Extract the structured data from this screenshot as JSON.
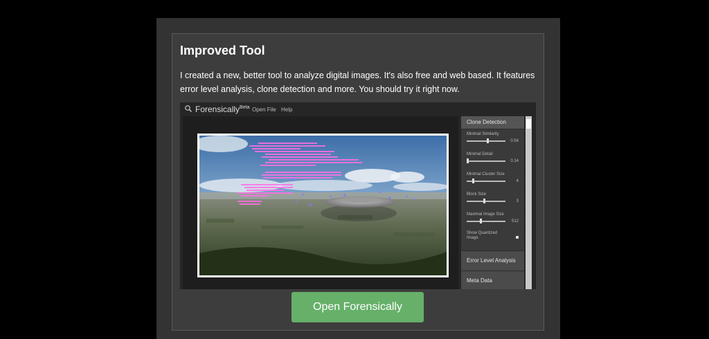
{
  "card": {
    "title": "Improved Tool",
    "description": "I created a new, better tool to analyze digital images. It's also free and web based. It features error level analysis, clone detection and more. You should try it right now."
  },
  "screenshot": {
    "app_name": "Forensically",
    "app_badge": "Beta",
    "menu": [
      "Open File",
      "Help"
    ],
    "panel_header": "Clone Detection",
    "controls": [
      {
        "label": "Minimal Similarity",
        "value": "0.54",
        "level": 0.54
      },
      {
        "label": "Minimal Detail",
        "value": "0.14",
        "level": 0.0
      },
      {
        "label": "Minimal Cluster Size",
        "value": "4",
        "level": 0.15
      },
      {
        "label": "Block Size",
        "value": "3",
        "level": 0.45
      },
      {
        "label": "Maximal Image Size",
        "value": "512",
        "level": 0.35
      }
    ],
    "checkbox_label": "Show Quantized Image",
    "sections": [
      "Error Level Analysis",
      "Meta Data"
    ]
  },
  "cta_button": "Open Forensically",
  "colors": {
    "page_background": "#000000",
    "card_background": "#3d3d3d",
    "button": "#66b06a",
    "highlight": "#ff6fe6"
  },
  "icons": {
    "magnifier": "search-icon"
  }
}
